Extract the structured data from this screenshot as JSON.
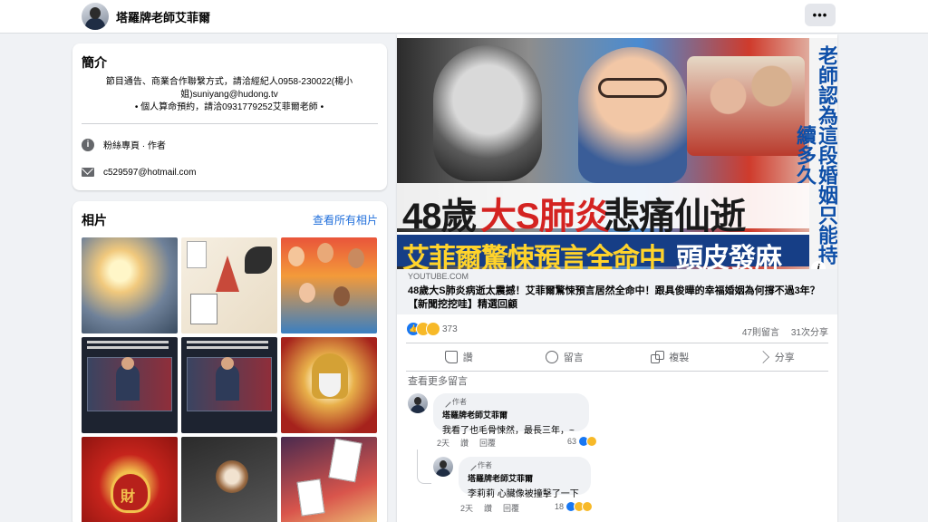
{
  "header": {
    "page_name": "塔羅牌老師艾菲爾"
  },
  "intro": {
    "title": "簡介",
    "bio_line1": "節目通告、商業合作聯繫方式，請洽經紀人0958-230022(楊小姐)suniyang@hudong.tv",
    "bio_line2": "• 個人算命預約，請洽0931779252艾菲爾老師 •",
    "category": "粉絲專頁 · 作者",
    "email": "c529597@hotmail.com"
  },
  "photos": {
    "title": "相片",
    "see_all": "查看所有相片"
  },
  "post": {
    "thumbnail": {
      "headline_black_1": "48歲",
      "headline_red": "大S肺炎",
      "headline_black_2": "悲痛仙逝",
      "headline_yellow": "艾菲爾驚悚預言全命中",
      "headline_white": "頭皮發麻",
      "side_text": "老師認為這段婚姻只能持續多久"
    },
    "link": {
      "domain": "YOUTUBE.COM",
      "title": "48歲大S肺炎病逝太震撼！艾菲爾驚悚預言居然全命中！跟具俊曄的幸福婚姻為何撐不過3年？【新聞挖挖哇】精選回顧"
    },
    "reactions_count": "373",
    "comments_count": "47則留言",
    "shares_count": "31次分享",
    "actions": {
      "like": "讚",
      "comment": "留言",
      "copy": "複製",
      "share": "分享"
    },
    "view_more_comments": "查看更多留言",
    "comments": [
      {
        "badge": "作者",
        "name": "塔羅牌老師艾菲爾",
        "text": "我看了也毛骨悚然，最長三年，~",
        "time": "2天",
        "like": "讚",
        "reply": "回覆",
        "reaction_count": "63"
      },
      {
        "badge": "作者",
        "name": "塔羅牌老師艾菲爾",
        "text": "李莉莉 心臟像被撞擊了一下",
        "time": "2天",
        "like": "讚",
        "reply": "回覆",
        "reaction_count": "18"
      }
    ]
  },
  "colors": {
    "link_blue": "#216fdb",
    "facebook_blue": "#1877f2",
    "headline_red": "#d42321",
    "headline_yellow": "#ffd32b",
    "banner_blue": "#163e86"
  }
}
